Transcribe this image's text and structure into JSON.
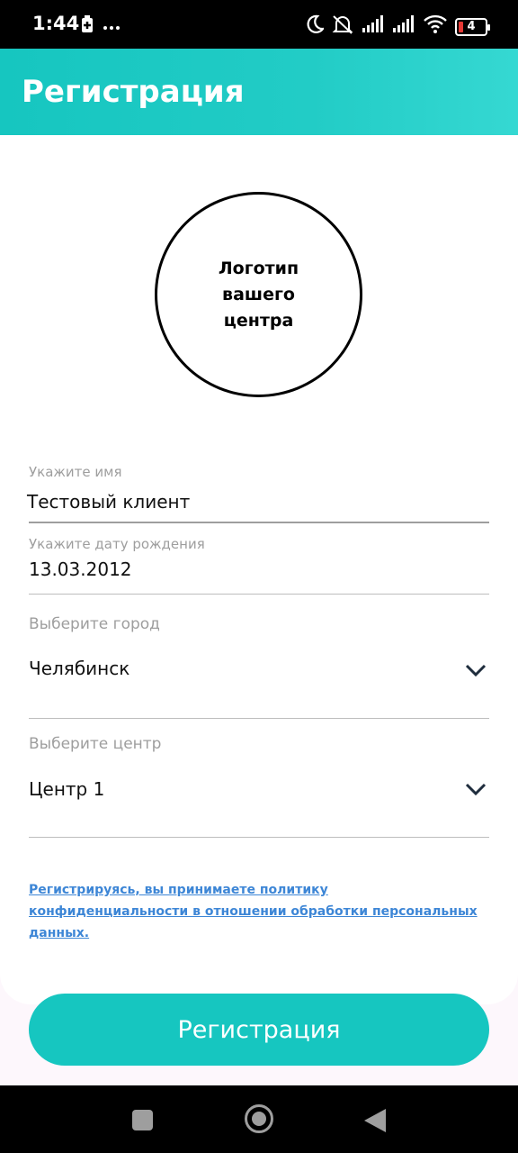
{
  "status_bar": {
    "time": "1:44",
    "battery_level": "4",
    "icons": [
      "battery-saver-icon",
      "more-dots-icon",
      "moon-icon",
      "mute-icon",
      "signal-icon",
      "signal-icon",
      "wifi-icon",
      "battery-icon"
    ]
  },
  "header": {
    "title": "Регистрация"
  },
  "logo": {
    "text": "Логотип вашего центра"
  },
  "form": {
    "name": {
      "label": "Укажите имя",
      "value": "Тестовый клиент"
    },
    "birth_date": {
      "label": "Укажите дату рождения",
      "value": "13.03.2012"
    },
    "city": {
      "label": "Выберите город",
      "value": "Челябинск"
    },
    "center": {
      "label": "Выберите центр",
      "value": "Центр 1"
    }
  },
  "policy": {
    "text": "Регистрируясь, вы принимаете политику конфиденциальности в отношении обработки персональных данных."
  },
  "actions": {
    "register_label": "Регистрация"
  },
  "colors": {
    "accent": "#16c6c0",
    "link": "#3d86d6",
    "label": "#9e9e9e"
  }
}
